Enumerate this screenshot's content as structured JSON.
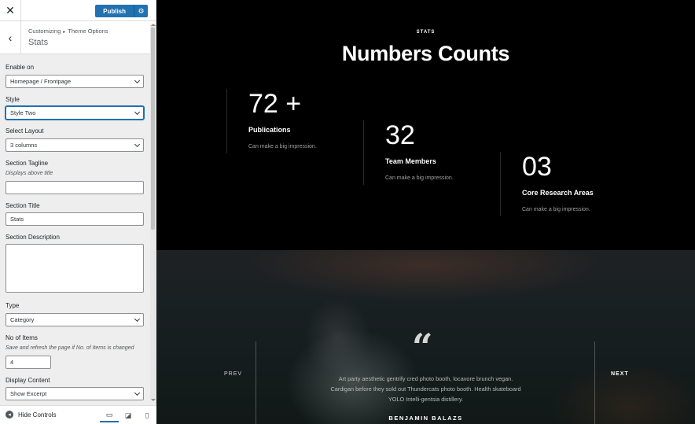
{
  "topbar": {
    "close_icon": "close-icon",
    "publish_label": "Publish",
    "publish_settings_icon": "gear-icon"
  },
  "section": {
    "breadcrumb_root": "Customizing",
    "breadcrumb_sep": "▸",
    "breadcrumb_parent": "Theme Options",
    "title": "Stats"
  },
  "controls": {
    "enable_on": {
      "label": "Enable on",
      "value": "Homepage / Frontpage"
    },
    "style": {
      "label": "Style",
      "value": "Style Two"
    },
    "layout": {
      "label": "Select Layout",
      "value": "3 columns"
    },
    "tagline": {
      "label": "Section Tagline",
      "desc": "Displays above title",
      "value": ""
    },
    "title": {
      "label": "Section Title",
      "value": "Stats"
    },
    "description": {
      "label": "Section Description",
      "value": ""
    },
    "type": {
      "label": "Type",
      "value": "Category"
    },
    "items": {
      "label": "No of Items",
      "desc": "Save and refresh the page if No. of Items is changed",
      "value": "4"
    },
    "display": {
      "label": "Display Content",
      "value": "Show Excerpt"
    }
  },
  "footer": {
    "hide_controls": "Hide Controls",
    "devices": [
      "desktop",
      "tablet",
      "mobile"
    ]
  },
  "preview": {
    "eyebrow": "STATS",
    "heading": "Numbers Counts",
    "stats": [
      {
        "number": "72 +",
        "label": "Publications",
        "desc": "Can make a big impression."
      },
      {
        "number": "32",
        "label": "Team Members",
        "desc": "Can make a big impression."
      },
      {
        "number": "03",
        "label": "Core Research Areas",
        "desc": "Can make a big impression."
      }
    ],
    "testimonial": {
      "prev": "PREV",
      "next": "NEXT",
      "quote_line1": "Art party aesthetic gentrify cred photo booth, locavore brunch vegan.",
      "quote_line2": "Cardigan before they sold out Thundercats photo booth. Health skateboard",
      "quote_line3": "YOLO Intelli-gentsia distillery.",
      "author": "BENJAMIN BALAZS"
    }
  },
  "colors": {
    "accent": "#2271b1",
    "sidebar_bg": "#eeeeee",
    "preview_bg": "#000000"
  }
}
